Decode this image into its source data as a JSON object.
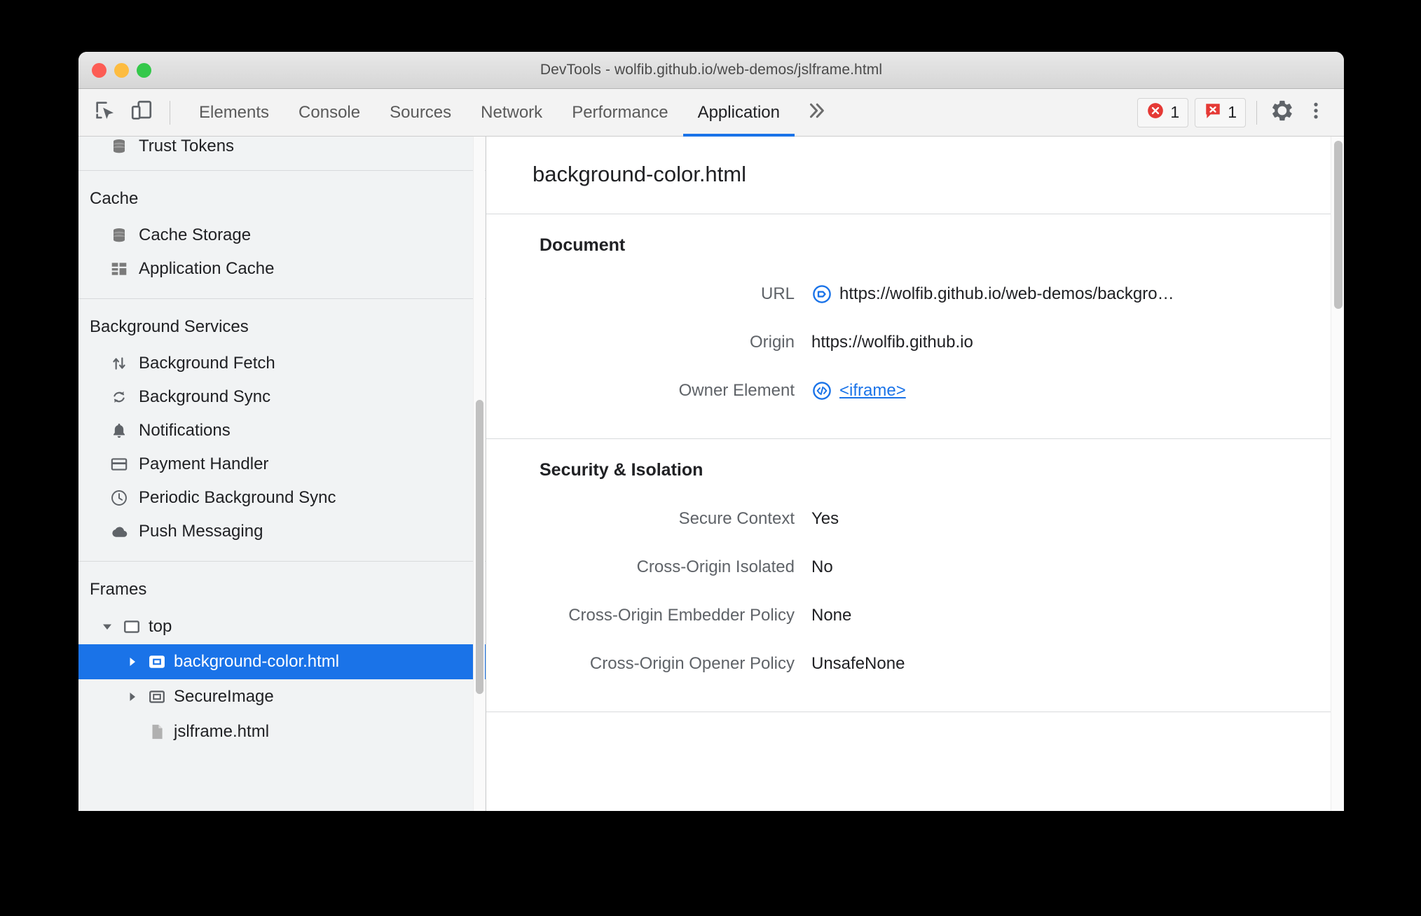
{
  "window": {
    "title": "DevTools - wolfib.github.io/web-demos/jslframe.html",
    "traffic_lights": [
      "close",
      "minimize",
      "zoom"
    ]
  },
  "toolbar": {
    "inspect_icon": "inspect-element-icon",
    "device_icon": "device-toolbar-icon",
    "tabs": [
      {
        "label": "Elements",
        "active": false
      },
      {
        "label": "Console",
        "active": false
      },
      {
        "label": "Sources",
        "active": false
      },
      {
        "label": "Network",
        "active": false
      },
      {
        "label": "Performance",
        "active": false
      },
      {
        "label": "Application",
        "active": true
      }
    ],
    "more_tabs_icon": "chevron-double-right-icon",
    "badges": [
      {
        "icon": "error-circle-icon",
        "count": "1",
        "color": "#e53935"
      },
      {
        "icon": "error-message-icon",
        "count": "1",
        "color": "#e53935"
      }
    ],
    "settings_icon": "gear-icon",
    "menu_icon": "kebab-menu-icon",
    "accent_color": "#1a73e8"
  },
  "sidebar": {
    "sections": [
      {
        "title": "",
        "items": [
          {
            "label": "Trust Tokens",
            "icon": "database-icon"
          }
        ]
      },
      {
        "title": "Cache",
        "items": [
          {
            "label": "Cache Storage",
            "icon": "database-icon"
          },
          {
            "label": "Application Cache",
            "icon": "grid-table-icon"
          }
        ]
      },
      {
        "title": "Background Services",
        "items": [
          {
            "label": "Background Fetch",
            "icon": "arrows-up-down-icon"
          },
          {
            "label": "Background Sync",
            "icon": "refresh-sync-icon"
          },
          {
            "label": "Notifications",
            "icon": "bell-icon"
          },
          {
            "label": "Payment Handler",
            "icon": "credit-card-icon"
          },
          {
            "label": "Periodic Background Sync",
            "icon": "clock-icon"
          },
          {
            "label": "Push Messaging",
            "icon": "cloud-icon"
          }
        ]
      }
    ],
    "frames": {
      "title": "Frames",
      "tree": [
        {
          "label": "top",
          "icon": "frame-icon",
          "depth": 1,
          "expanded": true,
          "selected": false,
          "has_arrow": true
        },
        {
          "label": "background-color.html",
          "icon": "iframe-icon",
          "depth": 2,
          "expanded": false,
          "selected": true,
          "has_arrow": true
        },
        {
          "label": "SecureImage",
          "icon": "iframe-icon",
          "depth": 2,
          "expanded": false,
          "selected": false,
          "has_arrow": true
        },
        {
          "label": "jslframe.html",
          "icon": "document-icon",
          "depth": 2,
          "expanded": false,
          "selected": false,
          "has_arrow": false
        }
      ]
    },
    "selection_color": "#1a73e8"
  },
  "main": {
    "frame_title": "background-color.html",
    "sections": [
      {
        "heading": "Document",
        "rows": [
          {
            "key": "URL",
            "value": "https://wolfib.github.io/web-demos/backgro…",
            "icon": "page-link-icon",
            "link": false
          },
          {
            "key": "Origin",
            "value": "https://wolfib.github.io",
            "icon": null,
            "link": false
          },
          {
            "key": "Owner Element",
            "value": "<iframe>",
            "icon": "code-circle-icon",
            "link": true
          }
        ]
      },
      {
        "heading": "Security & Isolation",
        "rows": [
          {
            "key": "Secure Context",
            "value": "Yes",
            "icon": null,
            "link": false
          },
          {
            "key": "Cross-Origin Isolated",
            "value": "No",
            "icon": null,
            "link": false
          },
          {
            "key": "Cross-Origin Embedder Policy",
            "value": "None",
            "icon": null,
            "link": false
          },
          {
            "key": "Cross-Origin Opener Policy",
            "value": "UnsafeNone",
            "icon": null,
            "link": false
          }
        ]
      }
    ]
  }
}
